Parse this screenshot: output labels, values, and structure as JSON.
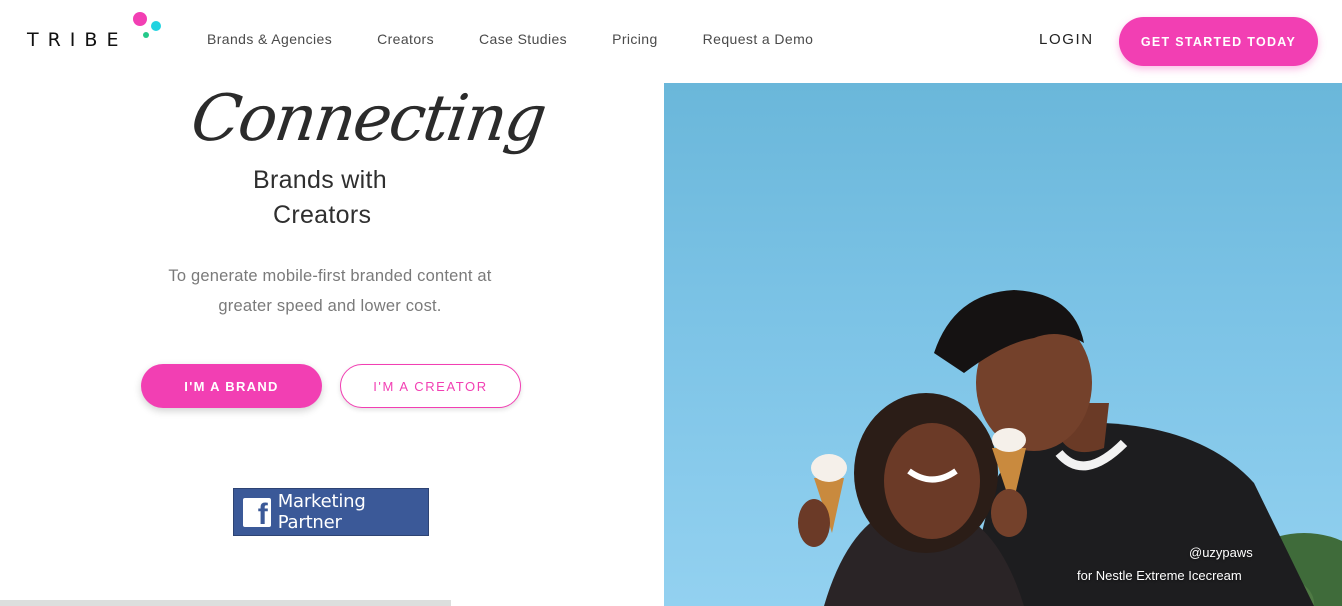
{
  "brand": {
    "logo_text": "TRIBE",
    "accent_color": "#f23fb3",
    "dot_colors": [
      "#f23fb3",
      "#22d3e0",
      "#25c98a"
    ]
  },
  "nav": {
    "links": [
      "Brands & Agencies",
      "Creators",
      "Case Studies",
      "Pricing",
      "Request a Demo"
    ],
    "login": "LOGIN",
    "cta": "GET STARTED TODAY"
  },
  "hero": {
    "script_title": "Connecting",
    "title_line2": "Brands with",
    "title_line3": "Creators",
    "subtitle_line1": "To generate mobile-first branded content at",
    "subtitle_line2": "greater speed and lower cost.",
    "brand_button": "I'M A BRAND",
    "creator_button": "I'M A CREATOR",
    "badge": {
      "icon": "facebook-icon",
      "text": "Marketing Partner",
      "color": "#3b5998"
    }
  },
  "photo": {
    "credit_handle": "@uzypaws",
    "credit_caption": "for Nestle Extreme Icecream"
  }
}
